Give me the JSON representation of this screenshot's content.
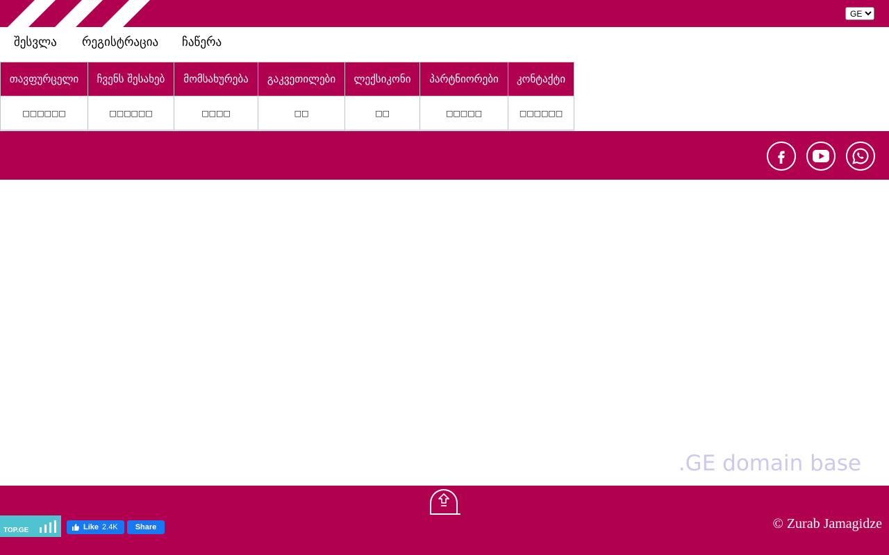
{
  "header": {
    "language": {
      "selected": "GE",
      "options": [
        "GE"
      ]
    }
  },
  "auth": {
    "login": "შესვლა",
    "register": "რეგისტრაცია",
    "enroll": "ჩაწერა"
  },
  "menu": {
    "items": [
      {
        "label": "თავფურცელი",
        "sub": "□□□□□□"
      },
      {
        "label": "ჩვენს შესახებ",
        "sub": "□□□□□□"
      },
      {
        "label": "მომსახურება",
        "sub": "□□□□"
      },
      {
        "label": "გაკვეთილები",
        "sub": "□□"
      },
      {
        "label": "ლექსიკონი",
        "sub": "□□"
      },
      {
        "label": "პარტნიორები",
        "sub": "□□□□□"
      },
      {
        "label": "კონტაქტი",
        "sub": "□□□□□□"
      }
    ]
  },
  "social": {
    "icons": [
      "facebook-icon",
      "youtube-icon",
      "whatsapp-icon"
    ]
  },
  "main": {
    "domain_base": ".GE domain base"
  },
  "footer": {
    "topge": "TOP.GE",
    "fb_like": "Like",
    "fb_like_count": "2.4K",
    "fb_share": "Share",
    "copyright": "© Zurab Jamagidze"
  },
  "colors": {
    "brand": "#b0004f",
    "domain_text": "#cfc8ee",
    "topge_bg": "#4fc3d0",
    "facebook": "#1877f2"
  }
}
